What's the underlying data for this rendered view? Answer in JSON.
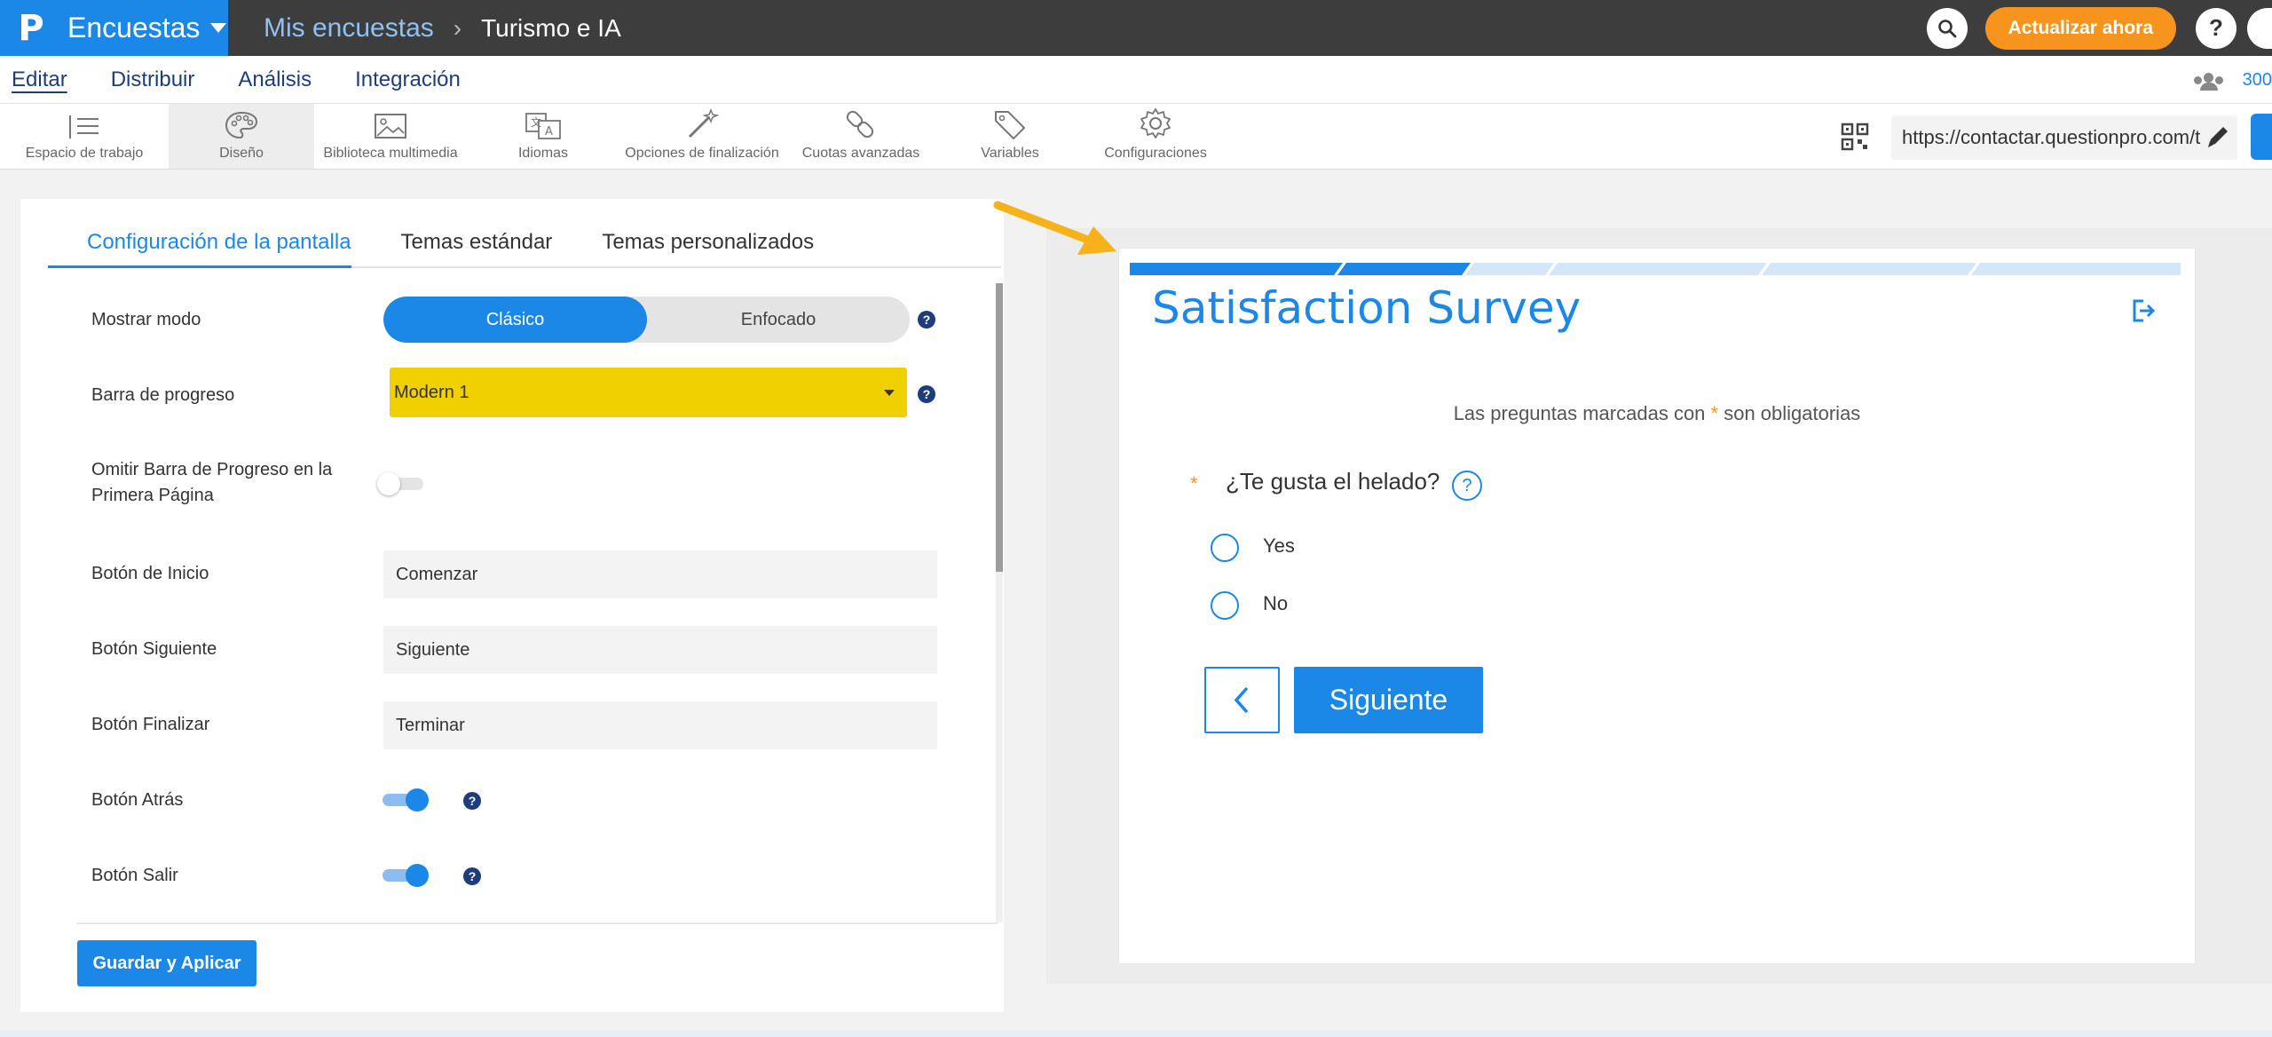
{
  "topbar": {
    "brand_letter": "P",
    "app_name": "Encuestas",
    "breadcrumb_link": "Mis encuestas",
    "breadcrumb_current": "Turismo e IA",
    "upgrade_label": "Actualizar ahora",
    "help_label": "?"
  },
  "menu": {
    "items": [
      "Editar",
      "Distribuir",
      "Análisis",
      "Integración"
    ],
    "right_count": "300"
  },
  "toolbar": {
    "tools": [
      {
        "label": "Espacio de trabajo",
        "icon": "workspace-icon"
      },
      {
        "label": "Diseño",
        "icon": "palette-icon"
      },
      {
        "label": "Biblioteca multimedia",
        "icon": "image-icon"
      },
      {
        "label": "Idiomas",
        "icon": "translate-icon"
      },
      {
        "label": "Opciones de finalización",
        "icon": "magic-wand-icon"
      },
      {
        "label": "Cuotas avanzadas",
        "icon": "link-icon"
      },
      {
        "label": "Variables",
        "icon": "tag-icon"
      },
      {
        "label": "Configuraciones",
        "icon": "gear-icon"
      }
    ],
    "url": "https://contactar.questionpro.com/t"
  },
  "panel": {
    "tabs": [
      "Configuración de la pantalla",
      "Temas estándar",
      "Temas personalizados"
    ],
    "mode_label": "Mostrar modo",
    "mode_options": [
      "Clásico",
      "Enfocado"
    ],
    "progress_label": "Barra de progreso",
    "progress_value": "Modern 1",
    "skip_progress_label_1": "Omitir Barra de Progreso en la",
    "skip_progress_label_2": "Primera Página",
    "start_button_label": "Botón de Inicio",
    "start_button_value": "Comenzar",
    "next_button_label": "Botón Siguiente",
    "next_button_value": "Siguiente",
    "finish_button_label": "Botón Finalizar",
    "finish_button_value": "Terminar",
    "back_button_label": "Botón Atrás",
    "exit_button_label": "Botón Salir",
    "save_label": "Guardar y Aplicar",
    "help_glyph": "?"
  },
  "preview": {
    "title": "Satisfaction Survey",
    "required_before": "Las preguntas marcadas con ",
    "required_star": "*",
    "required_after": " son obligatorias",
    "question_star": "*",
    "question": "¿Te gusta el helado?",
    "question_help": "?",
    "options": [
      "Yes",
      "No"
    ],
    "next_label": "Siguiente"
  },
  "colors": {
    "brand_blue": "#1b87e6",
    "upgrade_orange": "#f7941d",
    "select_yellow": "#f0d000",
    "topbar_dark": "#3d3d3d"
  }
}
